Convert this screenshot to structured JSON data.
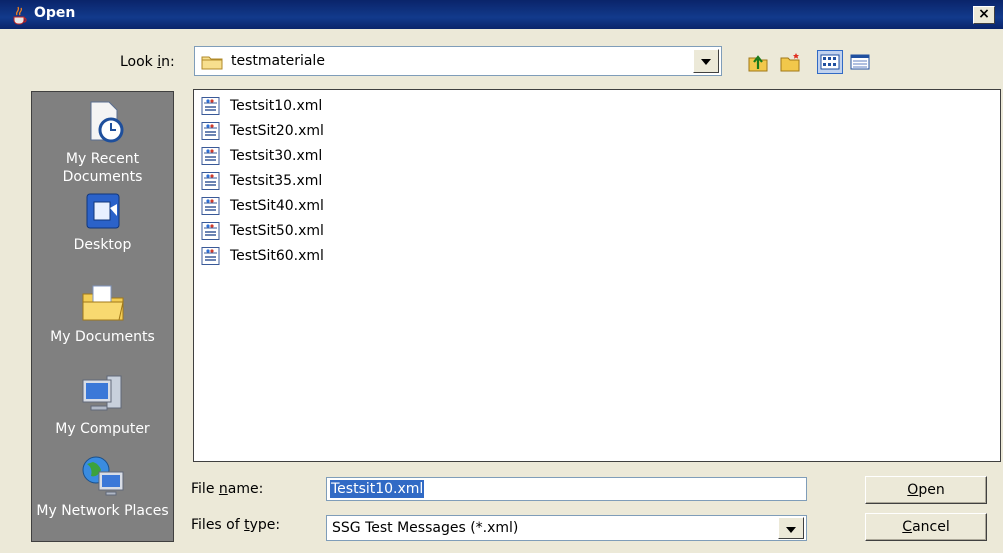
{
  "window": {
    "title": "Open",
    "close_glyph": "×"
  },
  "look_in": {
    "label_pre": "Look ",
    "label_key": "i",
    "label_post": "n:",
    "value": "testmateriale"
  },
  "toolbar": {
    "icons": [
      "up-one-level-icon",
      "create-new-folder-icon",
      "list-view-icon",
      "details-view-icon"
    ]
  },
  "sidebar": {
    "places": [
      {
        "label": "My Recent Documents",
        "icon": "recent-documents-icon"
      },
      {
        "label": "Desktop",
        "icon": "desktop-icon"
      },
      {
        "label": "My Documents",
        "icon": "my-documents-icon"
      },
      {
        "label": "My Computer",
        "icon": "my-computer-icon"
      },
      {
        "label": "My Network Places",
        "icon": "network-places-icon"
      }
    ]
  },
  "files": [
    {
      "name": "Testsit10.xml",
      "icon": "xml-file-icon"
    },
    {
      "name": "TestSit20.xml",
      "icon": "xml-file-icon"
    },
    {
      "name": "Testsit30.xml",
      "icon": "xml-file-icon"
    },
    {
      "name": "Testsit35.xml",
      "icon": "xml-file-icon"
    },
    {
      "name": "TestSit40.xml",
      "icon": "xml-file-icon"
    },
    {
      "name": "TestSit50.xml",
      "icon": "xml-file-icon"
    },
    {
      "name": "TestSit60.xml",
      "icon": "xml-file-icon"
    }
  ],
  "file_name": {
    "label_pre": "File ",
    "label_key": "n",
    "label_post": "ame:",
    "value": "Testsit10.xml"
  },
  "file_type": {
    "label_pre": "Files of ",
    "label_key": "t",
    "label_post": "ype:",
    "value": "SSG Test Messages (*.xml)"
  },
  "buttons": {
    "open": {
      "key": "O",
      "rest": "pen"
    },
    "cancel": {
      "key": "C",
      "rest": "ancel"
    }
  },
  "colors": {
    "title_bar": "#0a246a",
    "sidebar": "#808080",
    "selection": "#316ac5",
    "dialog": "#ece9d8"
  }
}
